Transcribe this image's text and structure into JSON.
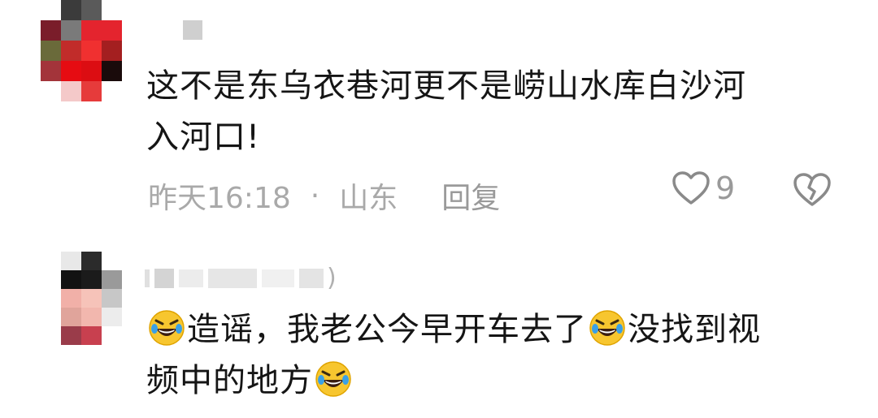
{
  "comments": [
    {
      "text_line1": "这不是东乌衣巷河更不是崂山水库白沙河",
      "text_line2": "入河口!",
      "time": "昨天16:18",
      "separator": "·",
      "location": "山东",
      "reply_label": "回复",
      "likes": "9"
    },
    {
      "name_suffix": ")",
      "seg1": "造谣，我老公今早开车去了",
      "seg2": "没找到视",
      "seg3": "频中的地方",
      "emoji_name": "rofl-emoji"
    }
  ],
  "icons": {
    "like": "heart-outline-icon",
    "dislike": "broken-heart-icon"
  }
}
